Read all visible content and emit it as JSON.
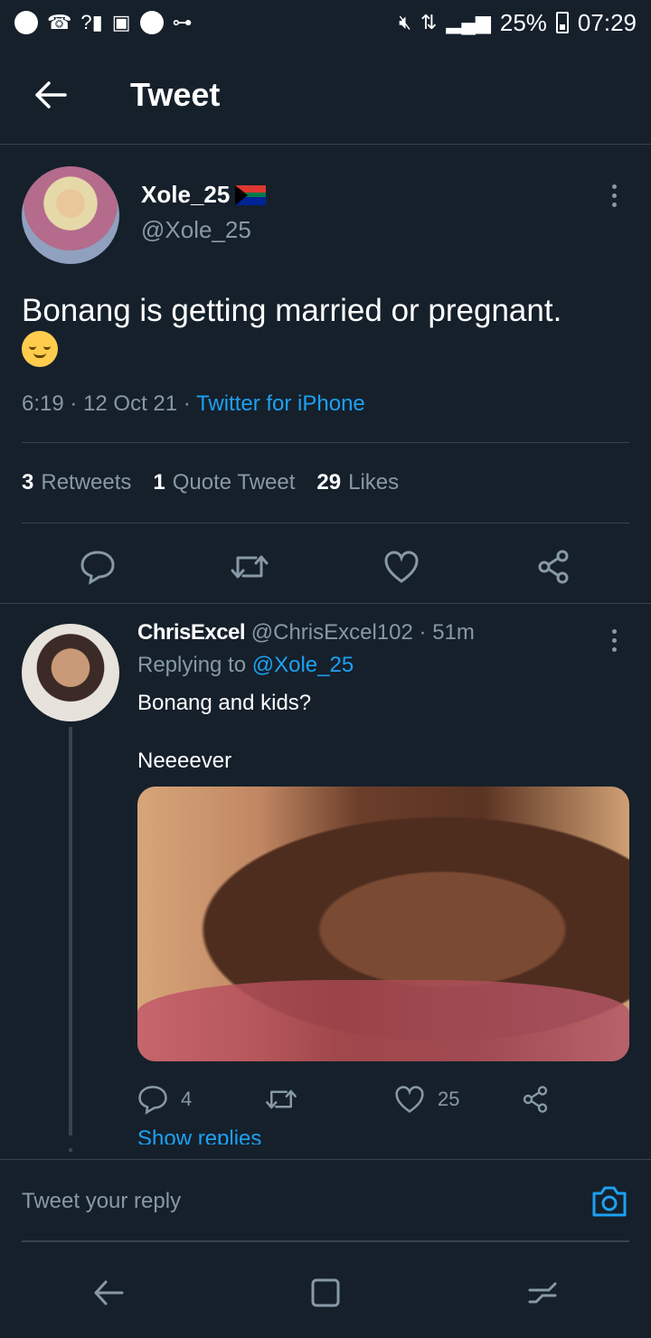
{
  "status_bar": {
    "battery": "25%",
    "time": "07:29"
  },
  "appbar": {
    "title": "Tweet"
  },
  "main_tweet": {
    "author_name": "Xole_25",
    "author_handle": "@Xole_25",
    "text": "Bonang is getting married or pregnant.",
    "time": "6:19",
    "date": "12 Oct 21",
    "source": "Twitter for iPhone",
    "stats": {
      "retweets_count": "3",
      "retweets_label": "Retweets",
      "quotes_count": "1",
      "quotes_label": "Quote Tweet",
      "likes_count": "29",
      "likes_label": "Likes"
    }
  },
  "reply": {
    "author_name": "ChrisExcel",
    "author_handle": "@ChrisExcel102",
    "age": "51m",
    "replying_label": "Replying to",
    "replying_handle": "@Xole_25",
    "text_line1": "Bonang and kids?",
    "text_line2": "Neeeever",
    "reply_count": "4",
    "like_count": "25",
    "show_replies": "Show replies"
  },
  "composer": {
    "placeholder": "Tweet your reply"
  },
  "colors": {
    "background": "#15202b",
    "accent": "#1da1f2",
    "muted": "#8899a6",
    "divider": "#38444d"
  }
}
